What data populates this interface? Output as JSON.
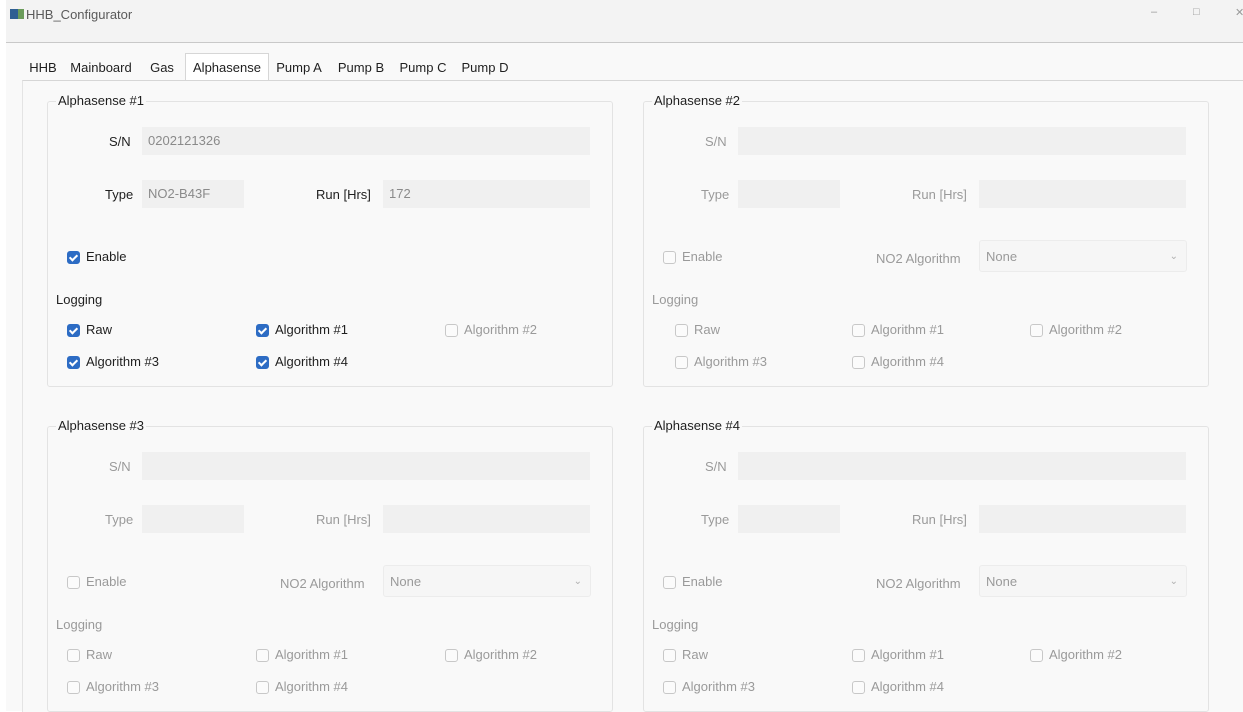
{
  "window": {
    "title": "HHB_Configurator",
    "minimize_glyph": "–",
    "maximize_glyph": "□",
    "close_glyph": "✕"
  },
  "colors": {
    "accent": "#2d6cc4",
    "panel_bg": "#f9f9f9",
    "disabled_text": "#9a9a9a"
  },
  "tabs": [
    {
      "label": "HHB",
      "active": false
    },
    {
      "label": "Mainboard",
      "active": false
    },
    {
      "label": "Gas",
      "active": false
    },
    {
      "label": "Alphasense",
      "active": true
    },
    {
      "label": "Pump A",
      "active": false
    },
    {
      "label": "Pump B",
      "active": false
    },
    {
      "label": "Pump C",
      "active": false
    },
    {
      "label": "Pump D",
      "active": false
    }
  ],
  "groups": [
    {
      "title": "Alphasense #1",
      "sn_label": "S/N",
      "sn_value": "0202121326",
      "type_label": "Type",
      "type_value": "NO2-B43F",
      "run_label": "Run [Hrs]",
      "run_value": "172",
      "enable_label": "Enable",
      "enable_checked": true,
      "algo_label": "",
      "algo_value": "",
      "logging_label": "Logging",
      "logging": [
        {
          "label": "Raw",
          "checked": true
        },
        {
          "label": "Algorithm #1",
          "checked": true
        },
        {
          "label": "Algorithm #2",
          "checked": false
        },
        {
          "label": "Algorithm #3",
          "checked": true
        },
        {
          "label": "Algorithm #4",
          "checked": true
        }
      ]
    },
    {
      "title": "Alphasense #2",
      "sn_label": "S/N",
      "sn_value": "",
      "type_label": "Type",
      "type_value": "",
      "run_label": "Run [Hrs]",
      "run_value": "",
      "enable_label": "Enable",
      "enable_checked": false,
      "algo_label": "NO2 Algorithm",
      "algo_value": "None",
      "logging_label": "Logging",
      "logging": [
        {
          "label": "Raw",
          "checked": false
        },
        {
          "label": "Algorithm #1",
          "checked": false
        },
        {
          "label": "Algorithm #2",
          "checked": false
        },
        {
          "label": "Algorithm #3",
          "checked": false
        },
        {
          "label": "Algorithm #4",
          "checked": false
        }
      ]
    },
    {
      "title": "Alphasense #3",
      "sn_label": "S/N",
      "sn_value": "",
      "type_label": "Type",
      "type_value": "",
      "run_label": "Run [Hrs]",
      "run_value": "",
      "enable_label": "Enable",
      "enable_checked": false,
      "algo_label": "NO2 Algorithm",
      "algo_value": "None",
      "logging_label": "Logging",
      "logging": [
        {
          "label": "Raw",
          "checked": false
        },
        {
          "label": "Algorithm #1",
          "checked": false
        },
        {
          "label": "Algorithm #2",
          "checked": false
        },
        {
          "label": "Algorithm #3",
          "checked": false
        },
        {
          "label": "Algorithm #4",
          "checked": false
        }
      ]
    },
    {
      "title": "Alphasense #4",
      "sn_label": "S/N",
      "sn_value": "",
      "type_label": "Type",
      "type_value": "",
      "run_label": "Run [Hrs]",
      "run_value": "",
      "enable_label": "Enable",
      "enable_checked": false,
      "algo_label": "NO2 Algorithm",
      "algo_value": "None",
      "logging_label": "Logging",
      "logging": [
        {
          "label": "Raw",
          "checked": false
        },
        {
          "label": "Algorithm #1",
          "checked": false
        },
        {
          "label": "Algorithm #2",
          "checked": false
        },
        {
          "label": "Algorithm #3",
          "checked": false
        },
        {
          "label": "Algorithm #4",
          "checked": false
        }
      ]
    }
  ]
}
